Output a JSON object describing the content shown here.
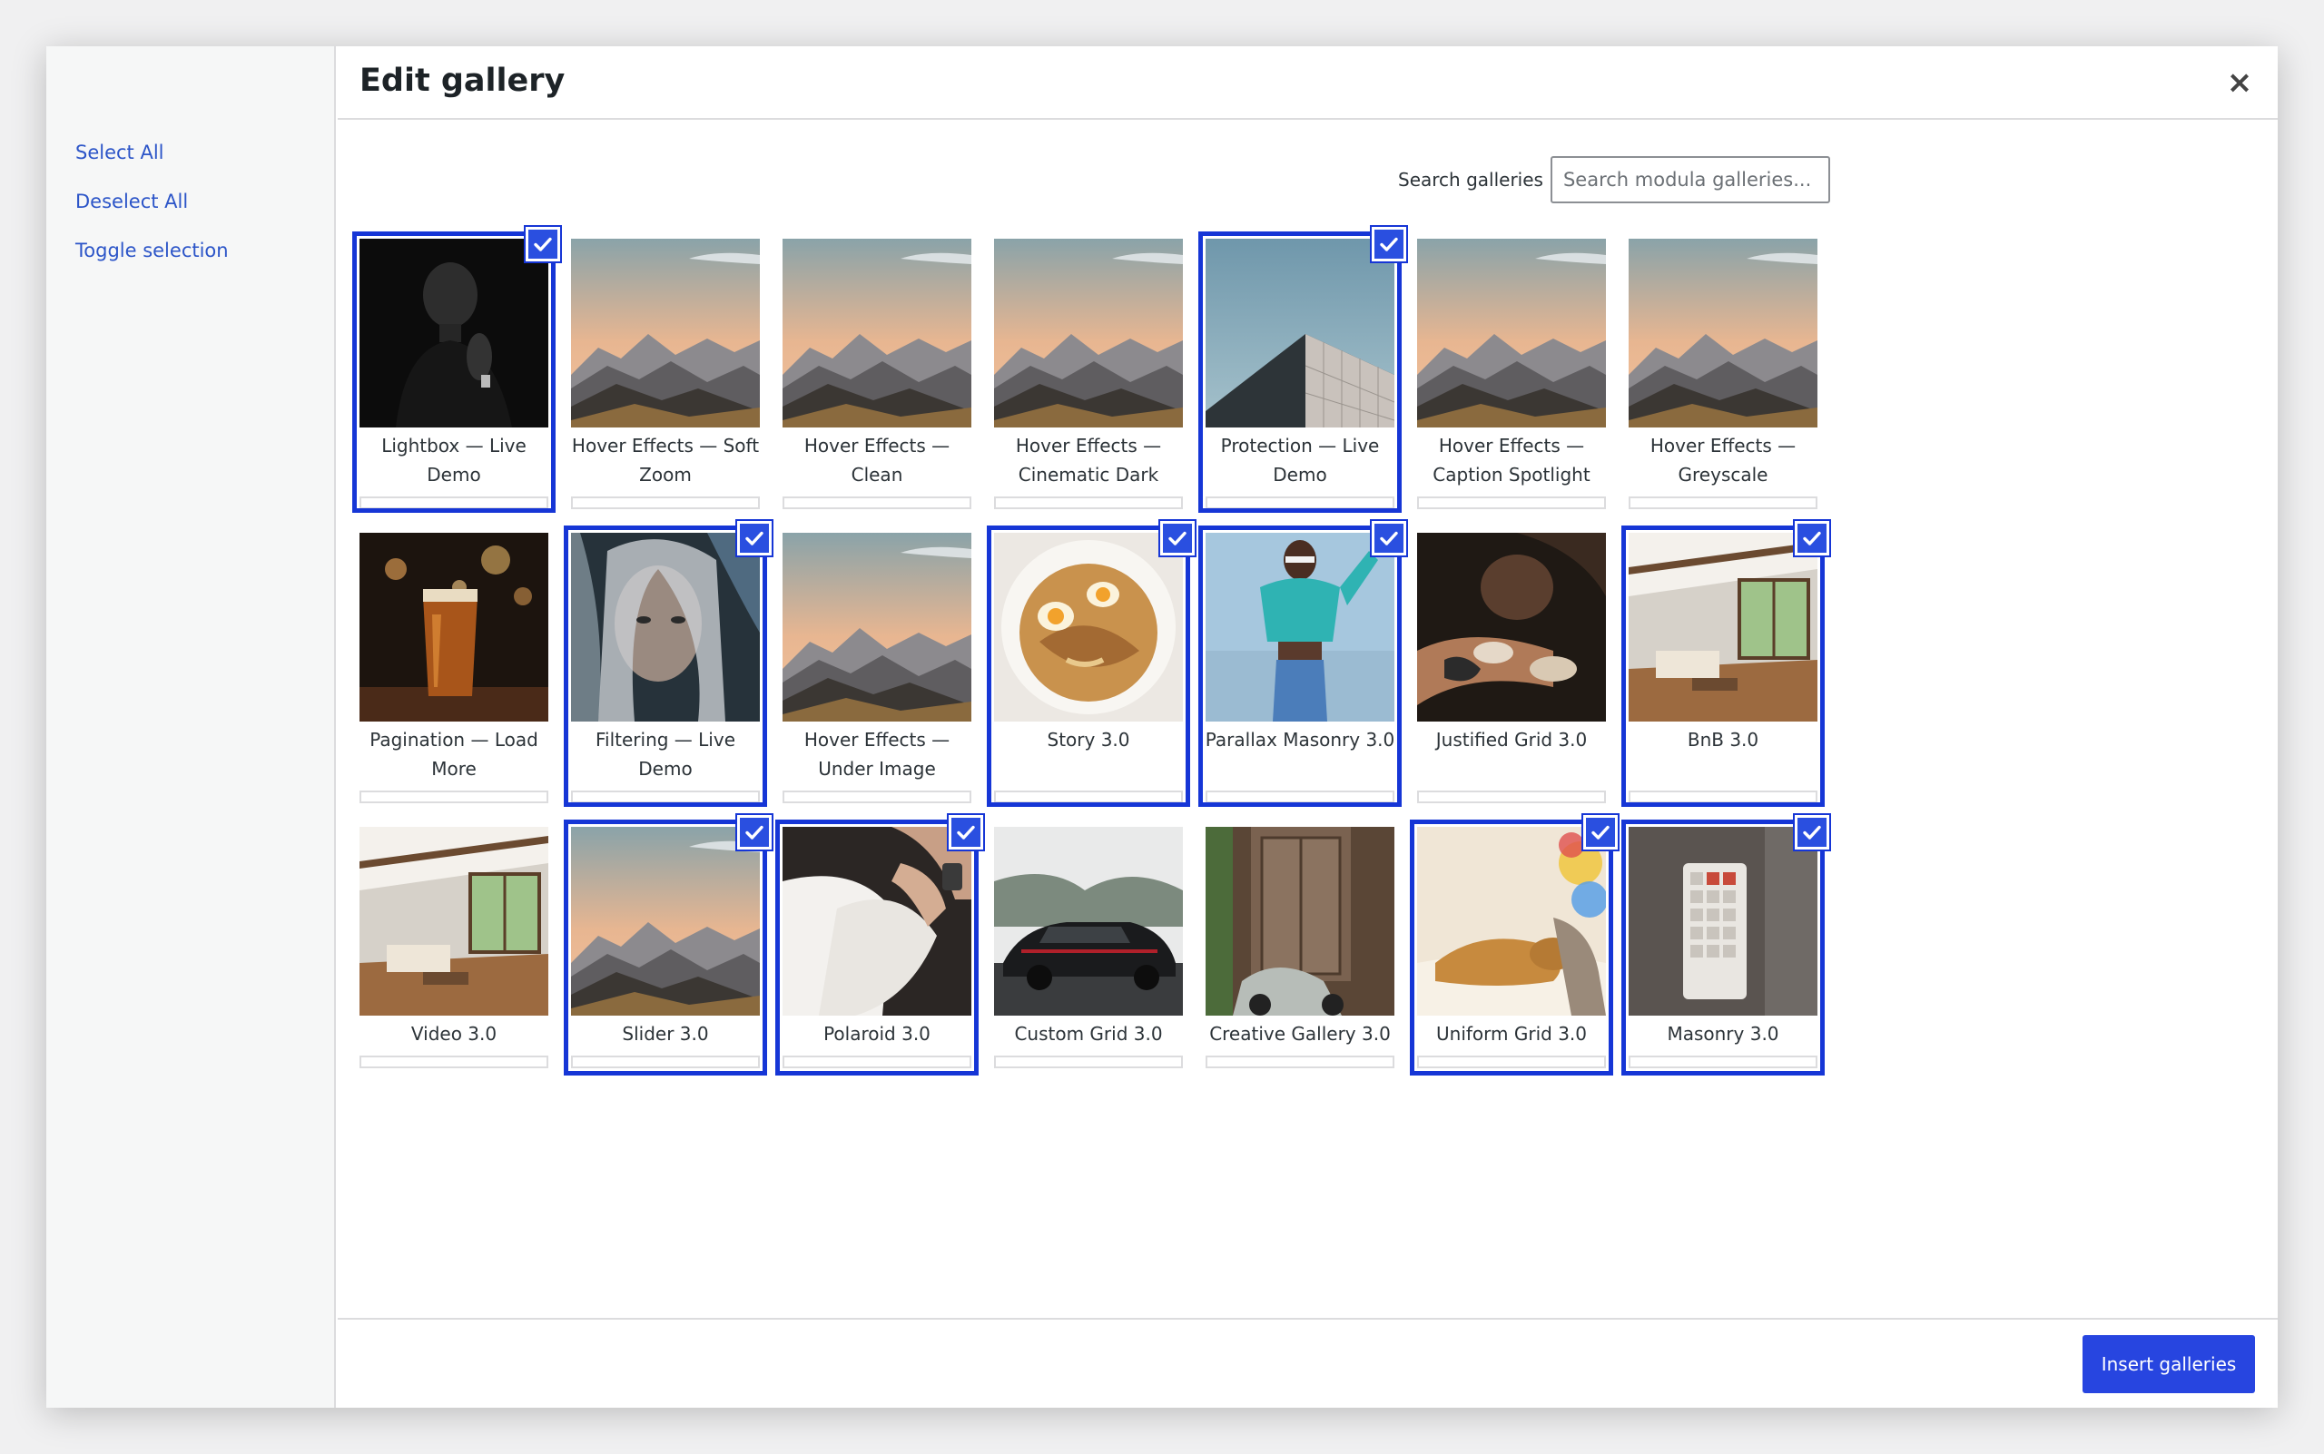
{
  "window": {
    "title": "Edit gallery",
    "close_label": "×"
  },
  "sidebar": {
    "items": [
      {
        "label": "Select All"
      },
      {
        "label": "Deselect All"
      },
      {
        "label": "Toggle selection"
      }
    ]
  },
  "search": {
    "label": "Search galleries",
    "placeholder": "Search modula galleries..."
  },
  "footer": {
    "insert_label": "Insert galleries"
  },
  "colors": {
    "accent": "#2745e0",
    "selected_border": "#1636d6",
    "link": "#2c55c8"
  },
  "galleries": [
    {
      "title": "Lightbox — Live Demo",
      "image": "portrait-bw",
      "selected": true
    },
    {
      "title": "Hover Effects — Soft Zoom",
      "image": "mountains",
      "selected": false
    },
    {
      "title": "Hover Effects — Clean",
      "image": "mountains",
      "selected": false
    },
    {
      "title": "Hover Effects — Cinematic Dark",
      "image": "mountains",
      "selected": false
    },
    {
      "title": "Protection — Live Demo",
      "image": "building-sky",
      "selected": true
    },
    {
      "title": "Hover Effects — Caption Spotlight",
      "image": "mountains",
      "selected": false
    },
    {
      "title": "Hover Effects — Greyscale",
      "image": "mountains",
      "selected": false
    },
    {
      "title": "Pagination — Load More",
      "image": "beer",
      "selected": false
    },
    {
      "title": "Filtering — Live Demo",
      "image": "woman-face",
      "selected": true
    },
    {
      "title": "Hover Effects — Under Image",
      "image": "mountains",
      "selected": false
    },
    {
      "title": "Story 3.0",
      "image": "ramen",
      "selected": true
    },
    {
      "title": "Parallax Masonry 3.0",
      "image": "fashion",
      "selected": true
    },
    {
      "title": "Justified Grid 3.0",
      "image": "tattoo",
      "selected": false
    },
    {
      "title": "BnB 3.0",
      "image": "interior",
      "selected": true
    },
    {
      "title": "Video 3.0",
      "image": "interior",
      "selected": false
    },
    {
      "title": "Slider 3.0",
      "image": "mountains",
      "selected": true
    },
    {
      "title": "Polaroid 3.0",
      "image": "baby-hands",
      "selected": true
    },
    {
      "title": "Custom Grid 3.0",
      "image": "car",
      "selected": false
    },
    {
      "title": "Creative Gallery 3.0",
      "image": "door-scooter",
      "selected": false
    },
    {
      "title": "Uniform Grid 3.0",
      "image": "sleeping-dog",
      "selected": true
    },
    {
      "title": "Masonry 3.0",
      "image": "keyboard",
      "selected": true
    }
  ]
}
